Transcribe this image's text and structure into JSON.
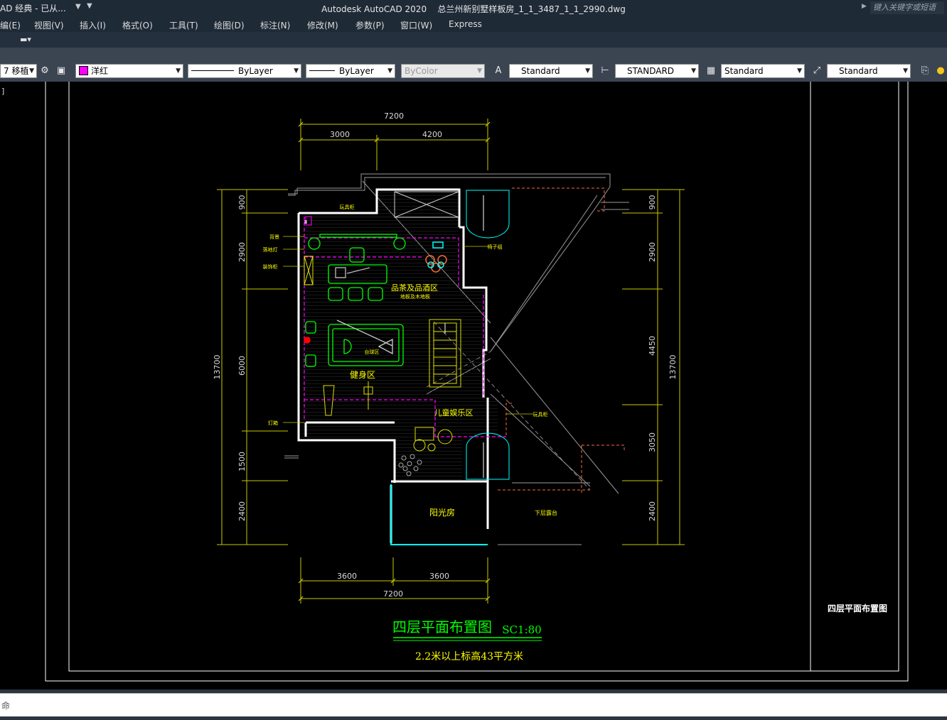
{
  "titlebar": {
    "workspace": "AD 经典 - 已从...",
    "app_title": "Autodesk AutoCAD 2020",
    "filename": "总兰州新别墅样板房_1_1_3487_1_1_2990.dwg",
    "search_placeholder": "键入关键字或短语"
  },
  "menu": [
    "编(E)",
    "视图(V)",
    "插入(I)",
    "格式(O)",
    "工具(T)",
    "绘图(D)",
    "标注(N)",
    "修改(M)",
    "参数(P)",
    "窗口(W)",
    "Express"
  ],
  "toolbar": {
    "layer": "7 移植",
    "color": "洋红",
    "linetype": "ByLayer",
    "lineweight": "ByLayer",
    "plotstyle": "ByColor",
    "text_style": "Standard",
    "dim_style": "STANDARD",
    "table_style": "Standard",
    "mleader_style": "Standard"
  },
  "colors": {
    "title_bg": "#1f2a37",
    "toolbar_bg": "#3b4552",
    "dimension": "#c8c800",
    "wall": "#ffffff",
    "furniture": "#00ff00",
    "zone_boundary": "#ff00ff",
    "title_text": "#00ff00",
    "label_text": "#ffff00",
    "glass": "#00ffff",
    "roof_line": "#ff6a3a"
  },
  "drawing": {
    "top_dims": [
      "7200",
      "3000",
      "4200"
    ],
    "bottom_dims": [
      "3600",
      "3600",
      "7200"
    ],
    "left_dims": [
      "900",
      "2900",
      "6000",
      "1500",
      "2400",
      "13700"
    ],
    "right_dims": [
      "900",
      "2900",
      "4450",
      "3050",
      "2400",
      "13700"
    ],
    "room_labels": {
      "tea_zone": "品茶及品酒区",
      "tea_sub": "地板及木地板",
      "fitness": "健身区",
      "billiards": "台球区",
      "kids": "儿童娱乐区",
      "sunroom": "阳光房",
      "lower_terrace": "下层露台"
    },
    "side_labels": {
      "toy_top": "玩具柜",
      "cabinet": "背景",
      "floor_lamp": "落地灯",
      "display": "装饰柜",
      "chair": "椅子",
      "wine_right": "椅子组",
      "lamp": "灯箱",
      "toy_right": "玩具柜"
    },
    "title": "四层平面布置图",
    "scale": "SC1:80",
    "subtitle": "2.2米以上标高43平方米",
    "frame_title": "四层平面布置图"
  },
  "command": {
    "prompt": "命"
  }
}
